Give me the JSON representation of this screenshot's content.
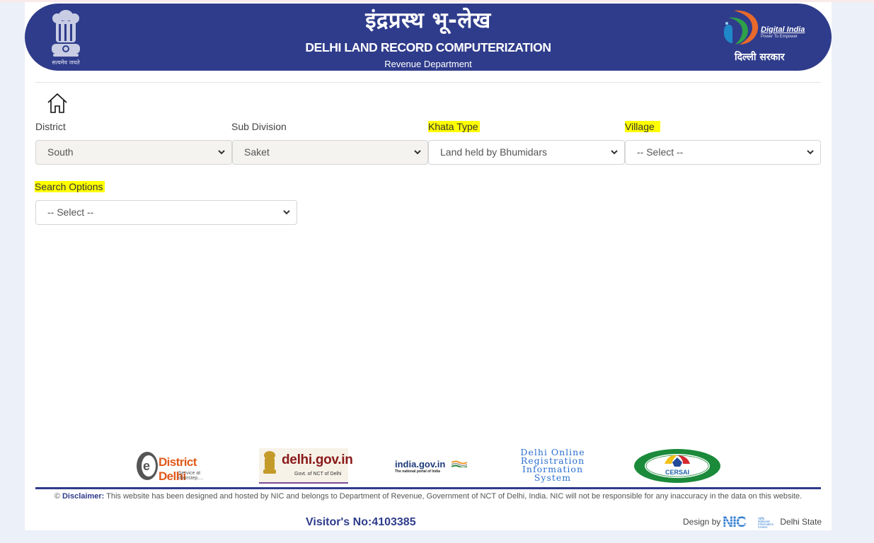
{
  "header": {
    "hindi_title": "इंद्रप्रस्थ भू-लेख",
    "title": "DELHI LAND RECORD COMPUTERIZATION",
    "subtitle": "Revenue Department",
    "emblem_caption": "सत्यमेव जयते",
    "digital_india": "Digital India",
    "digital_india_tagline": "Power To Empower",
    "delhi_sarkar": "दिल्ली सरकार",
    "brand_color": "#2f3c8b"
  },
  "nav": {
    "home_icon": "home-icon"
  },
  "form": {
    "district": {
      "label": "District",
      "value": "South"
    },
    "sub_division": {
      "label": "Sub Division",
      "value": "Saket"
    },
    "khata_type": {
      "label": "Khata Type",
      "value": "Land held by Bhumidars"
    },
    "village": {
      "label": "Village",
      "value": "-- Select --"
    },
    "search_options": {
      "label": "Search Options",
      "value": "-- Select --"
    },
    "highlight_color": "#ffff00"
  },
  "partner_logos": [
    {
      "name": "District Delhi",
      "tagline": "Service at doorstep...."
    },
    {
      "name": "delhi.gov.in",
      "tagline": "Govt. of NCT of Delhi"
    },
    {
      "name": "india.gov.in",
      "tagline": "The national portal of India"
    },
    {
      "name": "Delhi Online Registration Information System"
    },
    {
      "name": "CERSAI"
    }
  ],
  "footer": {
    "disclaimer_label": "Disclaimer:",
    "disclaimer_text": "This website has been designed and hosted by NIC and belongs to Department of Revenue, Government of NCT of Delhi, India. NIC will not be responsible for any inaccuracy in the data on this website.",
    "visitor_label": "Visitor's No:",
    "visitor_count": "4103385",
    "design_by": "Design by",
    "nic": "NIC",
    "nic_full": "National Informatics Centre",
    "delhi_state": "Delhi State"
  }
}
